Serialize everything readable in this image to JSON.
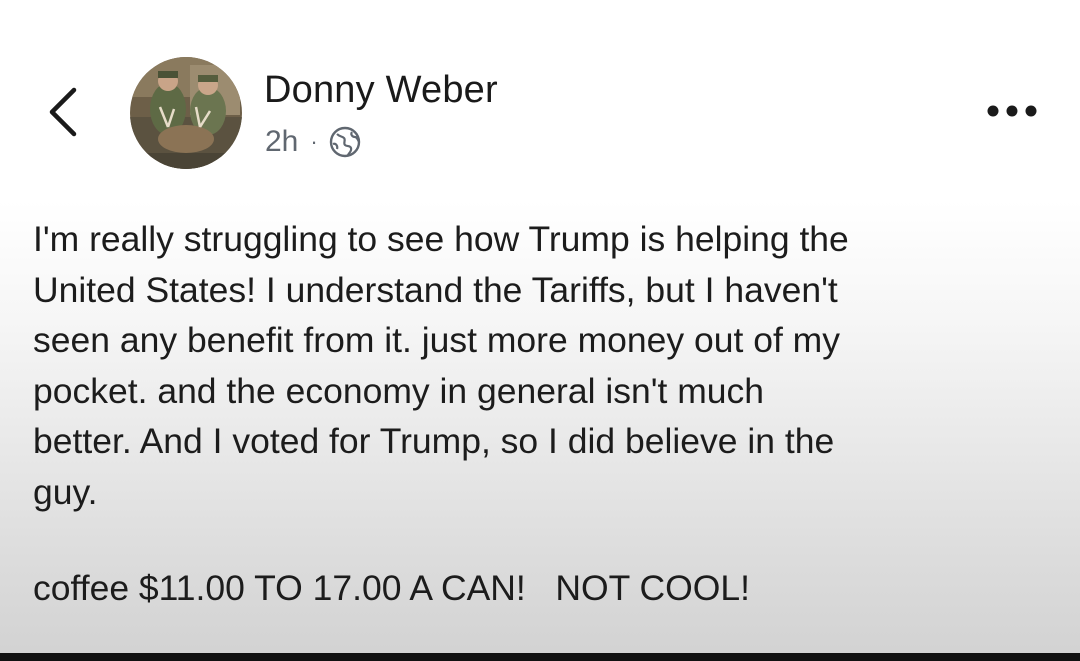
{
  "header": {
    "back_icon": "chevron-left-icon",
    "author_name": "Donny Weber",
    "timestamp": "2h",
    "separator": "·",
    "privacy_icon": "globe-icon",
    "more_icon": "ellipsis-icon"
  },
  "post": {
    "paragraph_1": "I'm really struggling to see how Trump is helping the\nUnited States! I understand the Tariffs, but I haven't\nseen any benefit from it. just more money out of my\npocket. and the economy in general isn't much\nbetter. And I voted for Trump, so I did believe in the\nguy.",
    "paragraph_2": "coffee $11.00 TO 17.00 A CAN!   NOT COOL!"
  },
  "colors": {
    "text": "#1c1c1c",
    "meta": "#606770",
    "background_top": "#ffffff",
    "background_bottom": "#d3d3d3"
  }
}
